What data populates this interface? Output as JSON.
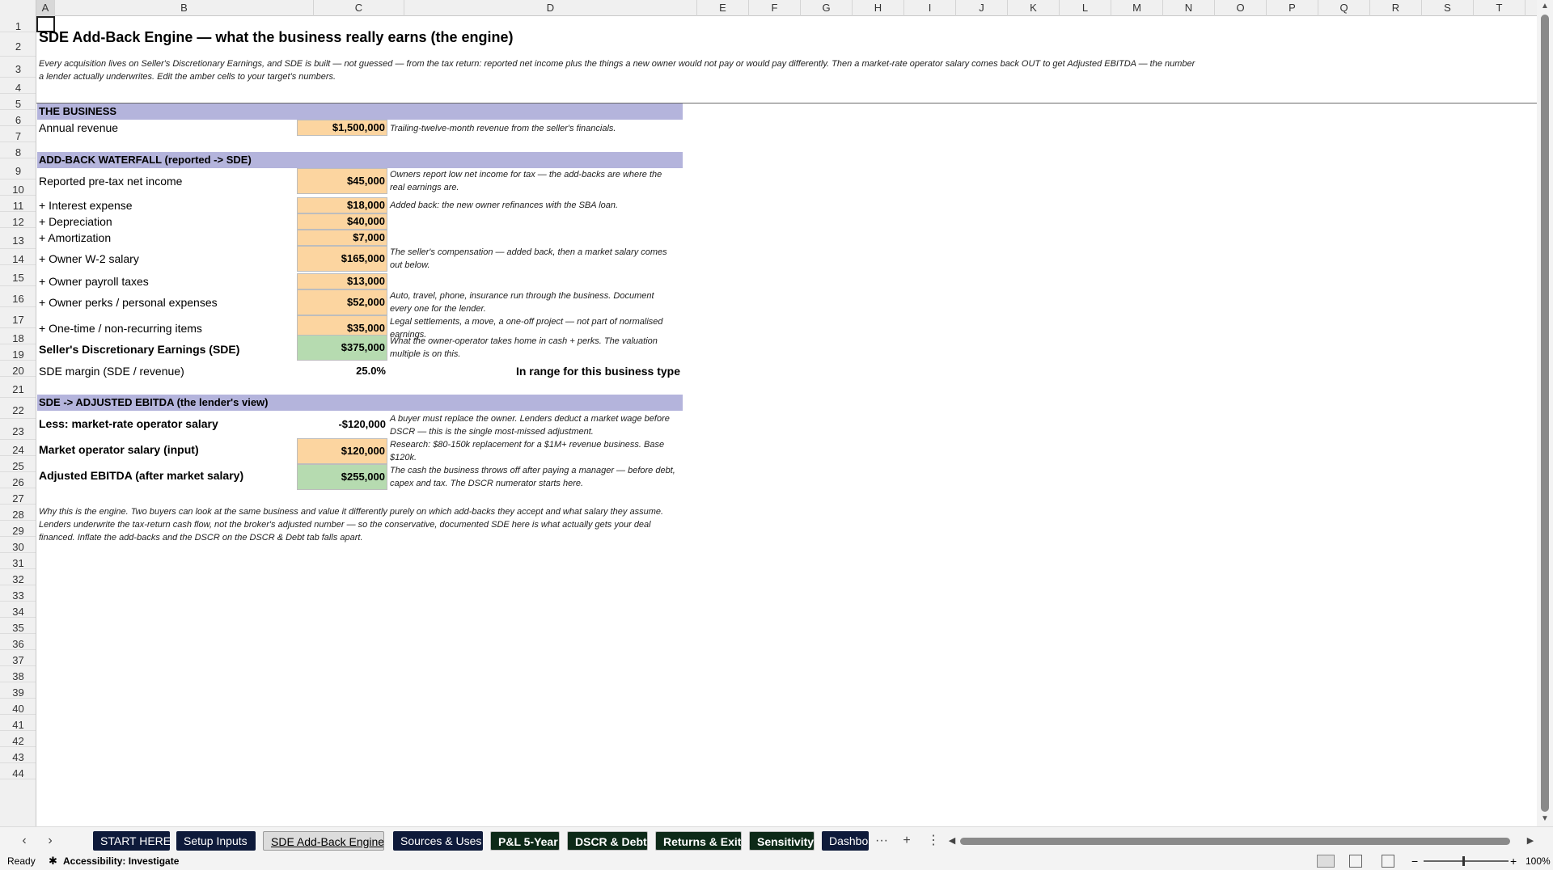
{
  "columns": [
    "A",
    "B",
    "C",
    "D",
    "E",
    "F",
    "G",
    "H",
    "I",
    "J",
    "K",
    "L",
    "M",
    "N",
    "O",
    "P",
    "Q",
    "R",
    "S",
    "T"
  ],
  "rows": [
    "1",
    "2",
    "3",
    "4",
    "5",
    "6",
    "7",
    "8",
    "9",
    "10",
    "11",
    "12",
    "13",
    "14",
    "15",
    "16",
    "17",
    "18",
    "19",
    "20",
    "21",
    "22",
    "23",
    "24",
    "25",
    "26",
    "27",
    "28",
    "29",
    "30",
    "31",
    "32",
    "33",
    "34",
    "35",
    "36",
    "37",
    "38",
    "39",
    "40",
    "41",
    "42",
    "43",
    "44"
  ],
  "title": "SDE Add-Back Engine — what the business really earns (the engine)",
  "intro": "Every acquisition lives on Seller's Discretionary Earnings, and SDE is built — not guessed — from the tax return: reported net income plus the things a new owner would not pay or would pay differently. Then a market-rate operator salary comes back OUT to get Adjusted EBITDA — the number a lender actually underwrites. Edit the amber cells to your target's numbers.",
  "business": {
    "header": "THE BUSINESS",
    "revenue_label": "Annual revenue",
    "revenue_value": "$1,500,000",
    "revenue_note": "Trailing-twelve-month revenue from the seller's financials."
  },
  "waterfall": {
    "header": "ADD-BACK WATERFALL  (reported -> SDE)",
    "items": [
      {
        "label": "Reported pre-tax net income",
        "value": "$45,000",
        "note": "Owners report low net income for tax — the add-backs are where the real earnings are."
      },
      {
        "label": "+ Interest expense",
        "value": "$18,000",
        "note": "Added back: the new owner refinances with the SBA loan."
      },
      {
        "label": "+ Depreciation",
        "value": "$40,000",
        "note": ""
      },
      {
        "label": "+ Amortization",
        "value": "$7,000",
        "note": ""
      },
      {
        "label": "+ Owner W-2 salary",
        "value": "$165,000",
        "note": "The seller's compensation — added back, then a market salary comes out below."
      },
      {
        "label": "+ Owner payroll taxes",
        "value": "$13,000",
        "note": ""
      },
      {
        "label": "+ Owner perks / personal expenses",
        "value": "$52,000",
        "note": "Auto, travel, phone, insurance run through the business. Document every one for the lender."
      },
      {
        "label": "+ One-time / non-recurring items",
        "value": "$35,000",
        "note": "Legal settlements, a move, a one-off project — not part of normalised earnings."
      }
    ],
    "sde_label": "Seller's Discretionary Earnings (SDE)",
    "sde_value": "$375,000",
    "sde_note": "What the owner-operator takes home in cash + perks. The valuation multiple is on this.",
    "margin_label": "SDE margin (SDE / revenue)",
    "margin_value": "25.0%",
    "margin_status": "In range for this business type"
  },
  "ebitda": {
    "header": "SDE -> ADJUSTED EBITDA  (the lender's view)",
    "less_label": "Less: market-rate operator salary",
    "less_value": "-$120,000",
    "less_note": "A buyer must replace the owner. Lenders deduct a market wage before DSCR — this is the single most-missed adjustment.",
    "market_label": "Market operator salary (input)",
    "market_value": "$120,000",
    "market_note": "Research: $80-150k replacement for a $1M+ revenue business. Base $120k.",
    "adj_label": "Adjusted EBITDA (after market salary)",
    "adj_value": "$255,000",
    "adj_note": "The cash the business throws off after paying a manager — before debt, capex and tax. The DSCR numerator starts here."
  },
  "footnote": "Why this is the engine. Two buyers can look at the same business and value it differently purely on which add-backs they accept and what salary they assume. Lenders underwrite the tax-return cash flow, not the broker's adjusted number — so the conservative, documented SDE here is what actually gets your deal financed. Inflate the add-backs and the DSCR on the DSCR & Debt tab falls apart.",
  "tabs": [
    "START HERE",
    "Setup Inputs",
    "SDE Add-Back Engine",
    "Sources & Uses",
    "P&L 5-Year",
    "DSCR & Debt",
    "Returns & Exit",
    "Sensitivity",
    "Dashboard"
  ],
  "tab_more": "···",
  "tab_add": "+",
  "tab_menu": "⋮",
  "status": {
    "ready": "Ready",
    "accessibility": "Accessibility: Investigate",
    "zoom": "100%",
    "zoom_minus": "−",
    "zoom_plus": "+"
  },
  "colors": {
    "amber_input": "#fcd5a0",
    "green_total": "#b6dbb0",
    "section_band": "#b4b4dc",
    "tab_navy": "#0e1a3a",
    "tab_green": "#0d2a18"
  }
}
